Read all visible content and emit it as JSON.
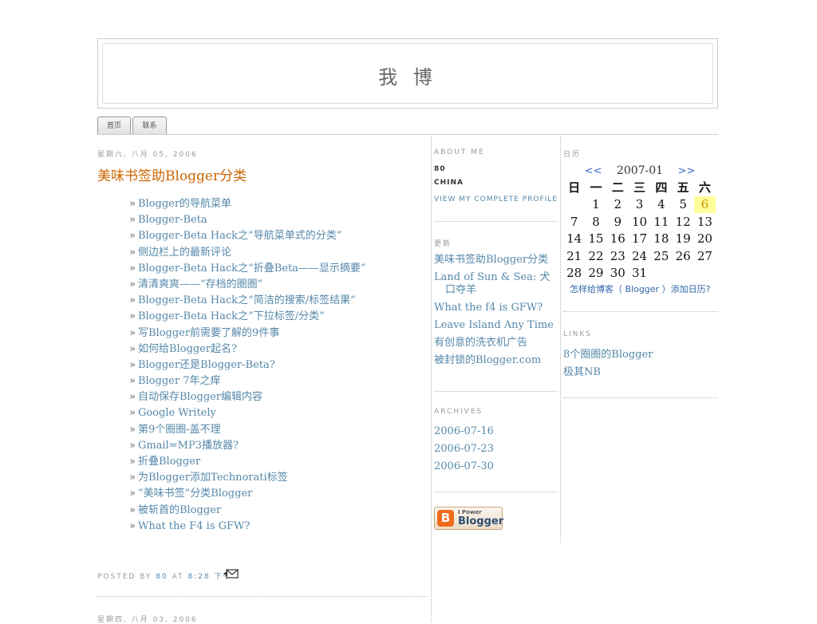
{
  "header": {
    "title": "我 博"
  },
  "tabs": [
    {
      "label": "首页"
    },
    {
      "label": "联系"
    }
  ],
  "post": {
    "date": "星期六, 八月 05, 2006",
    "title": "美味书签助Blogger分类",
    "links": [
      "Blogger的导航菜单",
      "Blogger-Beta",
      "Blogger-Beta Hack之“导航菜单式的分类”",
      "侧边栏上的最新评论",
      "Blogger-Beta Hack之“折叠Beta——显示摘要”",
      "清清爽爽——“存档的圈圈”",
      "Blogger-Beta Hack之“简洁的搜索/标签结果”",
      "Blogger-Beta Hack之“下拉标签/分类”",
      "写Blogger前需要了解的9件事",
      "如何给Blogger起名?",
      "Blogger还是Blogger-Beta?",
      "Blogger 7年之痒",
      "自动保存Blogger编辑内容",
      "Google Writely",
      "第9个圈圈-盖不理",
      "Gmail=MP3播放器?",
      "折叠Blogger",
      "为Blogger添加Technorati标签",
      "“美味书签”分类Blogger",
      "被斩首的Blogger",
      "What the F4 is GFW?"
    ],
    "footer_posted_by": "POSTED BY",
    "footer_author": "80",
    "footer_at": "AT",
    "footer_time": "8:28 下午",
    "next_date": "星期四, 八月 03, 2006"
  },
  "about": {
    "heading": "ABOUT ME",
    "name": "80",
    "location": "CHINA",
    "profile_link": "VIEW MY COMPLETE PROFILE"
  },
  "recent": {
    "heading": "更新",
    "items": [
      "美味书签助Blogger分类",
      "Land of Sun & Sea: 犬口夺羊",
      "What the f4 is GFW?",
      "Leave Island Any Time",
      "有创意的洗衣机广告",
      "被封锁的Blogger.com"
    ]
  },
  "archives": {
    "heading": "ARCHIVES",
    "items": [
      "2006-07-16",
      "2006-07-23",
      "2006-07-30"
    ]
  },
  "badge": {
    "small": "I Power",
    "word": "Blogger",
    "letter": "B"
  },
  "calendar": {
    "heading": "日历",
    "prev": "<<",
    "next": ">>",
    "month": "2007-01",
    "weekdays": [
      "日",
      "一",
      "二",
      "三",
      "四",
      "五",
      "六"
    ],
    "weeks": [
      [
        "",
        "1",
        "2",
        "3",
        "4",
        "5",
        "6"
      ],
      [
        "7",
        "8",
        "9",
        "10",
        "11",
        "12",
        "13"
      ],
      [
        "14",
        "15",
        "16",
        "17",
        "18",
        "19",
        "20"
      ],
      [
        "21",
        "22",
        "23",
        "24",
        "25",
        "26",
        "27"
      ],
      [
        "28",
        "29",
        "30",
        "31",
        "",
        "",
        ""
      ]
    ],
    "today": "6",
    "highlight_color": "#ffff99",
    "help": "怎样给博客（ Blogger ）添加日历?"
  },
  "links": {
    "heading": "LINKS",
    "items": [
      "8个圈圈的Blogger",
      "极其NB"
    ]
  },
  "colors": {
    "title": "#cc6600",
    "link": "#5588aa",
    "muted": "#999999"
  }
}
